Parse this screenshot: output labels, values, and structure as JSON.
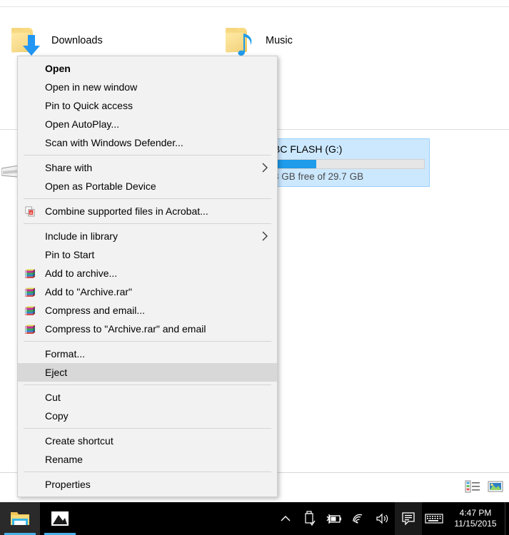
{
  "desktop": {
    "folders": [
      {
        "label": "Downloads",
        "icon": "folder-downloads-icon"
      },
      {
        "label": "Music",
        "icon": "folder-music-icon"
      }
    ]
  },
  "drive_tile": {
    "name": "BC FLASH (G:)",
    "free_text": "3 GB free of 29.7 GB",
    "used_percent": 28,
    "bar_color": "#1e9bea",
    "selection_color": "#cce8ff"
  },
  "context_menu": {
    "items": [
      {
        "label": "Open",
        "bold": true,
        "icon": null,
        "submenu": false,
        "highlight": false
      },
      {
        "label": "Open in new window",
        "bold": false,
        "icon": null,
        "submenu": false,
        "highlight": false
      },
      {
        "label": "Pin to Quick access",
        "bold": false,
        "icon": null,
        "submenu": false,
        "highlight": false
      },
      {
        "label": "Open AutoPlay...",
        "bold": false,
        "icon": null,
        "submenu": false,
        "highlight": false
      },
      {
        "label": "Scan with Windows Defender...",
        "bold": false,
        "icon": null,
        "submenu": false,
        "highlight": false
      },
      {
        "separator": true
      },
      {
        "label": "Share with",
        "bold": false,
        "icon": null,
        "submenu": true,
        "highlight": false
      },
      {
        "label": "Open as Portable Device",
        "bold": false,
        "icon": null,
        "submenu": false,
        "highlight": false
      },
      {
        "separator": true
      },
      {
        "label": "Combine supported files in Acrobat...",
        "bold": false,
        "icon": "acrobat-icon",
        "submenu": false,
        "highlight": false
      },
      {
        "separator": true
      },
      {
        "label": "Include in library",
        "bold": false,
        "icon": null,
        "submenu": true,
        "highlight": false
      },
      {
        "label": "Pin to Start",
        "bold": false,
        "icon": null,
        "submenu": false,
        "highlight": false
      },
      {
        "label": "Add to archive...",
        "bold": false,
        "icon": "winrar-icon",
        "submenu": false,
        "highlight": false
      },
      {
        "label": "Add to \"Archive.rar\"",
        "bold": false,
        "icon": "winrar-icon",
        "submenu": false,
        "highlight": false
      },
      {
        "label": "Compress and email...",
        "bold": false,
        "icon": "winrar-icon",
        "submenu": false,
        "highlight": false
      },
      {
        "label": "Compress to \"Archive.rar\" and email",
        "bold": false,
        "icon": "winrar-icon",
        "submenu": false,
        "highlight": false
      },
      {
        "separator": true
      },
      {
        "label": "Format...",
        "bold": false,
        "icon": null,
        "submenu": false,
        "highlight": false
      },
      {
        "label": "Eject",
        "bold": false,
        "icon": null,
        "submenu": false,
        "highlight": true
      },
      {
        "separator": true
      },
      {
        "label": "Cut",
        "bold": false,
        "icon": null,
        "submenu": false,
        "highlight": false
      },
      {
        "label": "Copy",
        "bold": false,
        "icon": null,
        "submenu": false,
        "highlight": false
      },
      {
        "separator": true
      },
      {
        "label": "Create shortcut",
        "bold": false,
        "icon": null,
        "submenu": false,
        "highlight": false
      },
      {
        "label": "Rename",
        "bold": false,
        "icon": null,
        "submenu": false,
        "highlight": false
      },
      {
        "separator": true
      },
      {
        "label": "Properties",
        "bold": false,
        "icon": null,
        "submenu": false,
        "highlight": false
      }
    ]
  },
  "view_buttons": [
    {
      "name": "details-view-button",
      "icon": "details-view-icon"
    },
    {
      "name": "large-icons-view-button",
      "icon": "large-icons-view-icon"
    }
  ],
  "taskbar": {
    "apps": [
      {
        "name": "file-explorer",
        "icon": "file-explorer-icon",
        "active": true
      },
      {
        "name": "photos",
        "icon": "photos-icon",
        "active": false
      }
    ],
    "tray_icons": [
      {
        "name": "show-hidden-icons",
        "icon": "chevron-up-icon"
      },
      {
        "name": "safely-remove-hardware",
        "icon": "usb-drive-icon"
      },
      {
        "name": "battery",
        "icon": "battery-charging-icon"
      },
      {
        "name": "network",
        "icon": "wifi-icon"
      },
      {
        "name": "volume",
        "icon": "speaker-icon"
      },
      {
        "name": "action-center",
        "icon": "notification-icon"
      },
      {
        "name": "touch-keyboard",
        "icon": "keyboard-icon"
      }
    ],
    "clock": {
      "time": "4:47 PM",
      "date": "11/15/2015"
    }
  }
}
